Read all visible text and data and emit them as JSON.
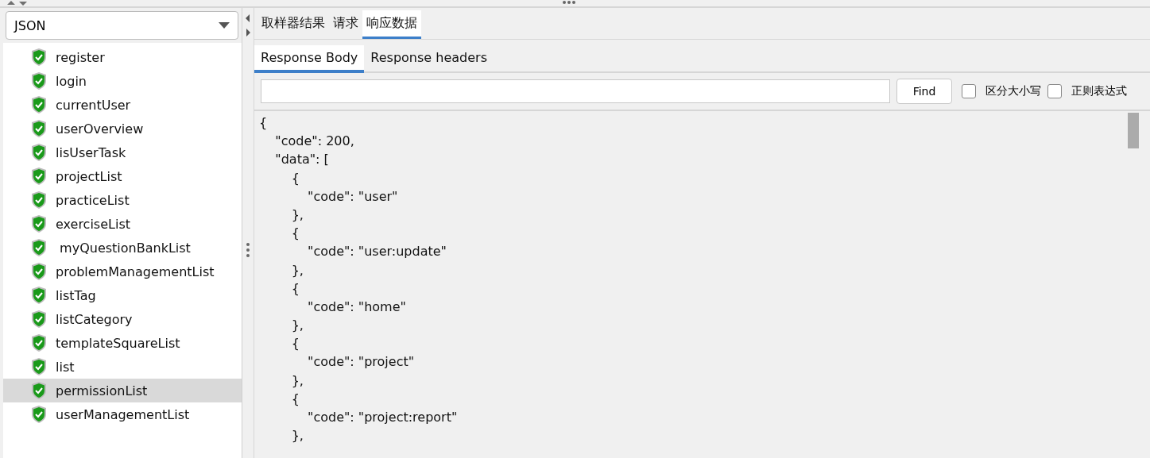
{
  "format_select": {
    "value": "JSON"
  },
  "samplers": [
    {
      "label": "register",
      "selected": false
    },
    {
      "label": "login",
      "selected": false
    },
    {
      "label": "currentUser",
      "selected": false
    },
    {
      "label": "userOverview",
      "selected": false
    },
    {
      "label": "lisUserTask",
      "selected": false
    },
    {
      "label": "projectList",
      "selected": false
    },
    {
      "label": "practiceList",
      "selected": false
    },
    {
      "label": "exerciseList",
      "selected": false
    },
    {
      "label": " myQuestionBankList",
      "selected": false
    },
    {
      "label": "problemManagementList",
      "selected": false
    },
    {
      "label": "listTag",
      "selected": false
    },
    {
      "label": "listCategory",
      "selected": false
    },
    {
      "label": "templateSquareList",
      "selected": false
    },
    {
      "label": "list",
      "selected": false
    },
    {
      "label": "permissionList",
      "selected": true
    },
    {
      "label": "userManagementList",
      "selected": false
    }
  ],
  "tabs": [
    {
      "label": "取样器结果",
      "selected": false
    },
    {
      "label": "请求",
      "selected": false
    },
    {
      "label": "响应数据",
      "selected": true
    }
  ],
  "sub_tabs": [
    {
      "label": "Response Body",
      "selected": true
    },
    {
      "label": "Response headers",
      "selected": false
    }
  ],
  "search": {
    "button": "Find",
    "options": [
      {
        "label": "区分大小写",
        "checked": false
      },
      {
        "label": "正则表达式",
        "checked": false
      }
    ]
  },
  "response_body": [
    "{",
    "    \"code\": 200,",
    "    \"data\": [",
    "        {",
    "            \"code\": \"user\"",
    "        },",
    "        {",
    "            \"code\": \"user:update\"",
    "        },",
    "        {",
    "            \"code\": \"home\"",
    "        },",
    "        {",
    "            \"code\": \"project\"",
    "        },",
    "        {",
    "            \"code\": \"project:report\"",
    "        },"
  ]
}
